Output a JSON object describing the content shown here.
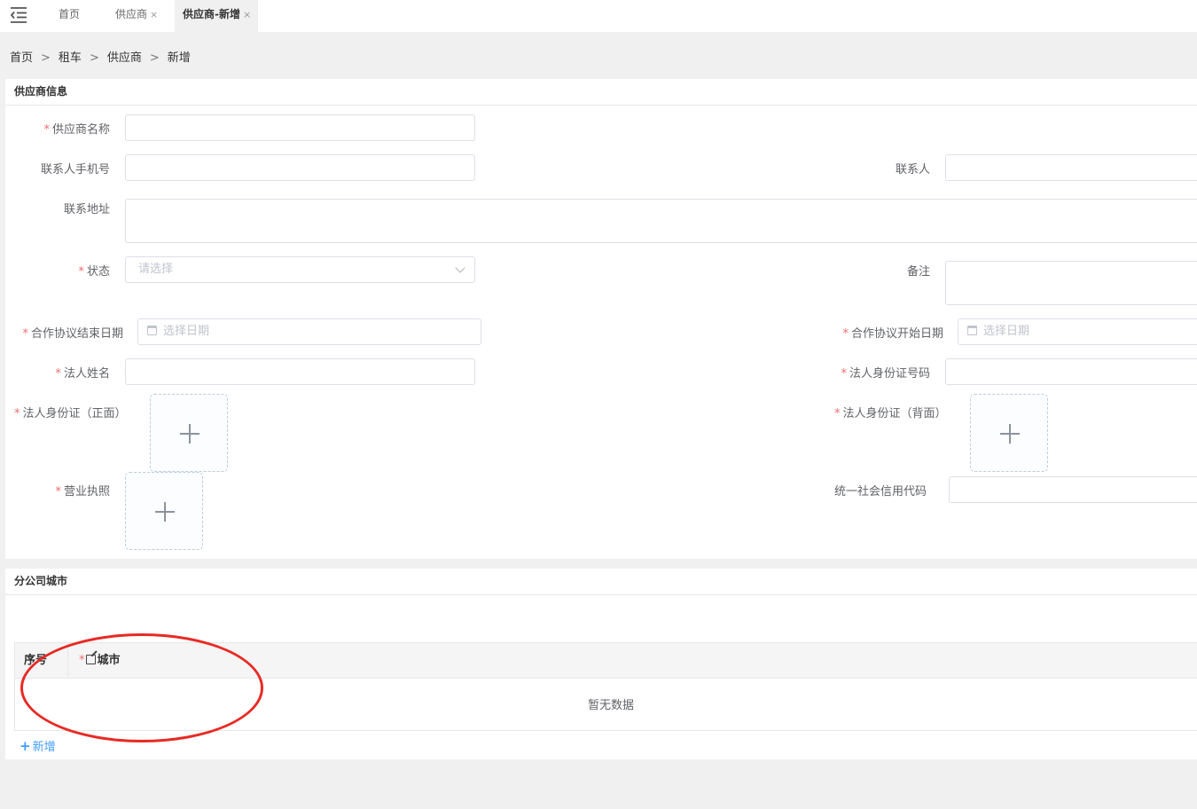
{
  "tabs": [
    {
      "label": "首页",
      "closable": false,
      "active": false
    },
    {
      "label": "供应商",
      "closable": true,
      "active": false
    },
    {
      "label": "供应商-新增",
      "closable": true,
      "active": true
    }
  ],
  "tab_close_glyph": "×",
  "breadcrumb": [
    "首页",
    "租车",
    "供应商",
    "新增"
  ],
  "breadcrumb_separator": ">",
  "supplier_panel": {
    "title": "供应商信息",
    "fields": {
      "supplier_name": {
        "label": "供应商名称",
        "required": true,
        "value": ""
      },
      "contact_phone": {
        "label": "联系人手机号",
        "required": false,
        "value": ""
      },
      "contact_person": {
        "label": "联系人",
        "required": false,
        "value": ""
      },
      "contact_address": {
        "label": "联系地址",
        "required": false,
        "value": ""
      },
      "status": {
        "label": "状态",
        "required": true,
        "placeholder": "请选择"
      },
      "remarks": {
        "label": "备注",
        "required": false,
        "value": ""
      },
      "agreement_end_date": {
        "label": "合作协议结束日期",
        "required": true,
        "placeholder": "选择日期"
      },
      "agreement_start_date": {
        "label": "合作协议开始日期",
        "required": true,
        "placeholder": "选择日期"
      },
      "legal_person_name": {
        "label": "法人姓名",
        "required": true,
        "value": ""
      },
      "legal_person_id_number": {
        "label": "法人身份证号码",
        "required": true,
        "value": ""
      },
      "id_card_front": {
        "label": "法人身份证（正面）",
        "required": true
      },
      "id_card_back": {
        "label": "法人身份证（背面）",
        "required": true
      },
      "business_license": {
        "label": "营业执照",
        "required": true
      },
      "credit_code": {
        "label": "统一社会信用代码",
        "required": false,
        "value": ""
      }
    }
  },
  "branch_panel": {
    "title": "分公司城市",
    "table": {
      "columns": [
        {
          "label": "序号",
          "required": false
        },
        {
          "label": "城市",
          "required": true,
          "editable_icon": "edit-icon"
        }
      ],
      "rows": [],
      "empty_text": "暂无数据"
    },
    "add_button": {
      "label": "新增",
      "icon": "plus-icon"
    }
  },
  "colors": {
    "required_mark": "#f56c6c",
    "link": "#409eff",
    "annotation_circle": "#e82a24",
    "page_background": "#f0f0f0"
  }
}
